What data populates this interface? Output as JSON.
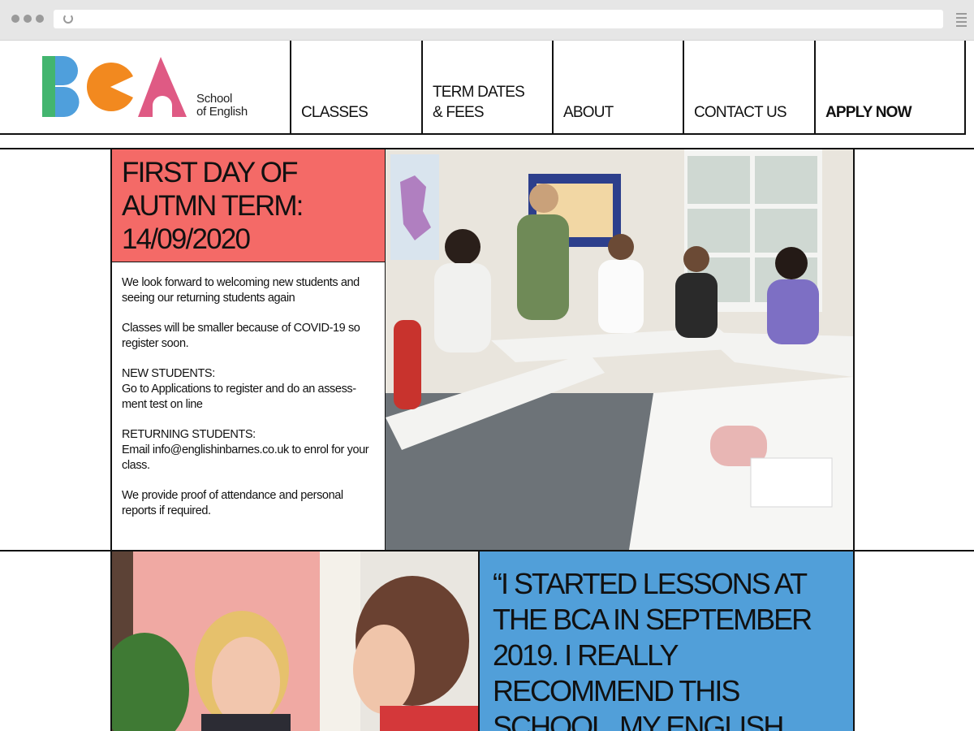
{
  "browser": {
    "window_dots": [
      "dot",
      "dot",
      "dot"
    ]
  },
  "logo": {
    "letters": "BCA",
    "text_line1": "School",
    "text_line2": "of English",
    "colors": {
      "b_green": "#43b56f",
      "b_blue": "#4f9fdc",
      "c_orange": "#f2891f",
      "a_pink": "#df5a84"
    }
  },
  "nav": {
    "classes": "CLASSES",
    "term_line1": "TERM DATES",
    "term_line2": "& FEES",
    "about": "ABOUT",
    "contact": "CONTACT US",
    "apply": "APPLY NOW"
  },
  "announcement": {
    "heading_line1": "FIRST DAY OF",
    "heading_line2": "AUTMN TERM:",
    "heading_line3": "14/09/2020",
    "p1": "We look forward to welcoming new students and seeing our returning students again",
    "p2": "Classes will be smaller because of COVID-19 so register soon.",
    "new_label": "NEW STUDENTS:",
    "new_text": "Go to Applications to register and do an assess­ment test on line",
    "returning_label": "RETURNING STUDENTS:",
    "returning_text": "Email info@englishinbarnes.co.uk to enrol for your class.",
    "p5": "We provide proof of attendance and personal reports if required.",
    "accent_color": "#f46a67"
  },
  "testimonial": {
    "quote": "“I STARTED LESSONS AT THE BCA IN SEPTEMBER 2019. I REALLY RECOMMEND THIS SCHOOL. MY ENGLISH",
    "accent_color": "#519fd9"
  }
}
